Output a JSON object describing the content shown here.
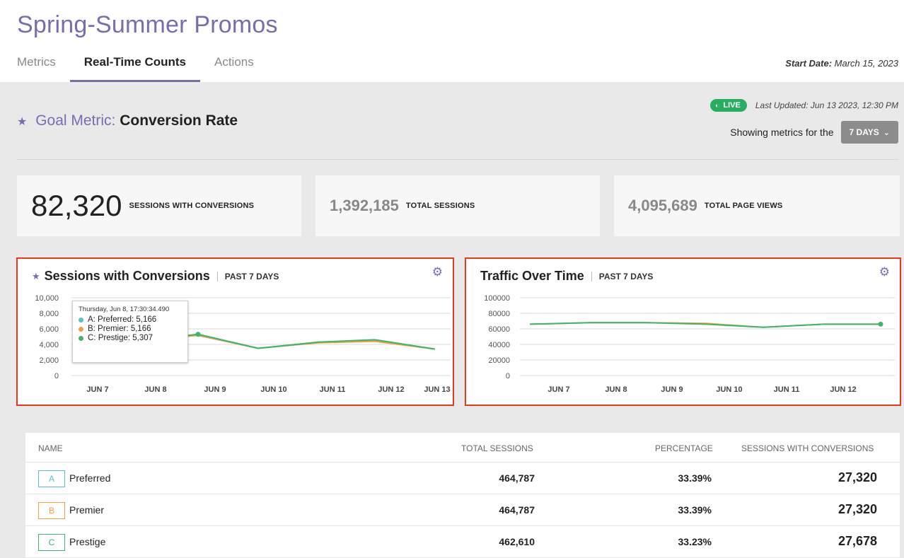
{
  "header": {
    "title": "Spring-Summer Promos",
    "tabs": [
      {
        "label": "Metrics"
      },
      {
        "label": "Real-Time Counts"
      },
      {
        "label": "Actions"
      }
    ],
    "start_date_label": "Start Date:",
    "start_date_value": "March 15, 2023"
  },
  "goal": {
    "label": "Goal Metric:",
    "value": "Conversion Rate"
  },
  "status": {
    "live": "LIVE",
    "last_updated": "Last Updated: Jun 13 2023, 12:30 PM",
    "showing_prefix": "Showing metrics for the",
    "range": "7 DAYS"
  },
  "stats": [
    {
      "value": "82,320",
      "label": "SESSIONS WITH CONVERSIONS"
    },
    {
      "value": "1,392,185",
      "label": "TOTAL SESSIONS"
    },
    {
      "value": "4,095,689",
      "label": "TOTAL PAGE VIEWS"
    }
  ],
  "colors": {
    "accent": "#7b6bb0",
    "A": "#5bc0c8",
    "B": "#f0a040",
    "C": "#3db56a",
    "highlight": "#e63b18"
  },
  "chart_data": [
    {
      "type": "line",
      "title": "Sessions with Conversions",
      "subtitle": "PAST 7 DAYS",
      "x": [
        "JUN 7",
        "JUN 8",
        "JUN 9",
        "JUN 10",
        "JUN 11",
        "JUN 12",
        "JUN 13"
      ],
      "ylim": [
        0,
        10000
      ],
      "yticks": [
        "10,000",
        "8,000",
        "6,000",
        "4,000",
        "2,000",
        "0"
      ],
      "series": [
        {
          "name": "A: Preferred",
          "values": [
            4300,
            4700,
            5166,
            3500,
            4300,
            4500,
            3400
          ]
        },
        {
          "name": "B: Premier",
          "values": [
            4300,
            4700,
            5166,
            3500,
            4200,
            4400,
            3400
          ]
        },
        {
          "name": "C: Prestige",
          "values": [
            4300,
            4700,
            5307,
            3500,
            4300,
            4600,
            3400
          ]
        }
      ],
      "tooltip": {
        "title": "Thursday, Jun 8, 17:30:34.490",
        "rows": [
          "A: Preferred: 5,166",
          "B: Premier: 5,166",
          "C: Prestige: 5,307"
        ]
      }
    },
    {
      "type": "line",
      "title": "Traffic Over Time",
      "subtitle": "PAST 7 DAYS",
      "x": [
        "JUN 7",
        "JUN 8",
        "JUN 9",
        "JUN 10",
        "JUN 11",
        "JUN 12"
      ],
      "ylim": [
        0,
        100000
      ],
      "yticks": [
        "100000",
        "80000",
        "60000",
        "40000",
        "20000",
        "0"
      ],
      "series": [
        {
          "values": [
            66000,
            68000,
            68000,
            67000,
            62000,
            66000,
            66000
          ]
        },
        {
          "values": [
            66000,
            68000,
            68000,
            66000,
            62000,
            66000,
            66000
          ]
        }
      ]
    }
  ],
  "table": {
    "headers": [
      "NAME",
      "TOTAL SESSIONS",
      "PERCENTAGE",
      "SESSIONS WITH CONVERSIONS"
    ],
    "rows": [
      {
        "badge": "A",
        "name": "Preferred",
        "total": "464,787",
        "pct": "33.39%",
        "conv": "27,320"
      },
      {
        "badge": "B",
        "name": "Premier",
        "total": "464,787",
        "pct": "33.39%",
        "conv": "27,320"
      },
      {
        "badge": "C",
        "name": "Prestige",
        "total": "462,610",
        "pct": "33.23%",
        "conv": "27,678"
      }
    ]
  }
}
